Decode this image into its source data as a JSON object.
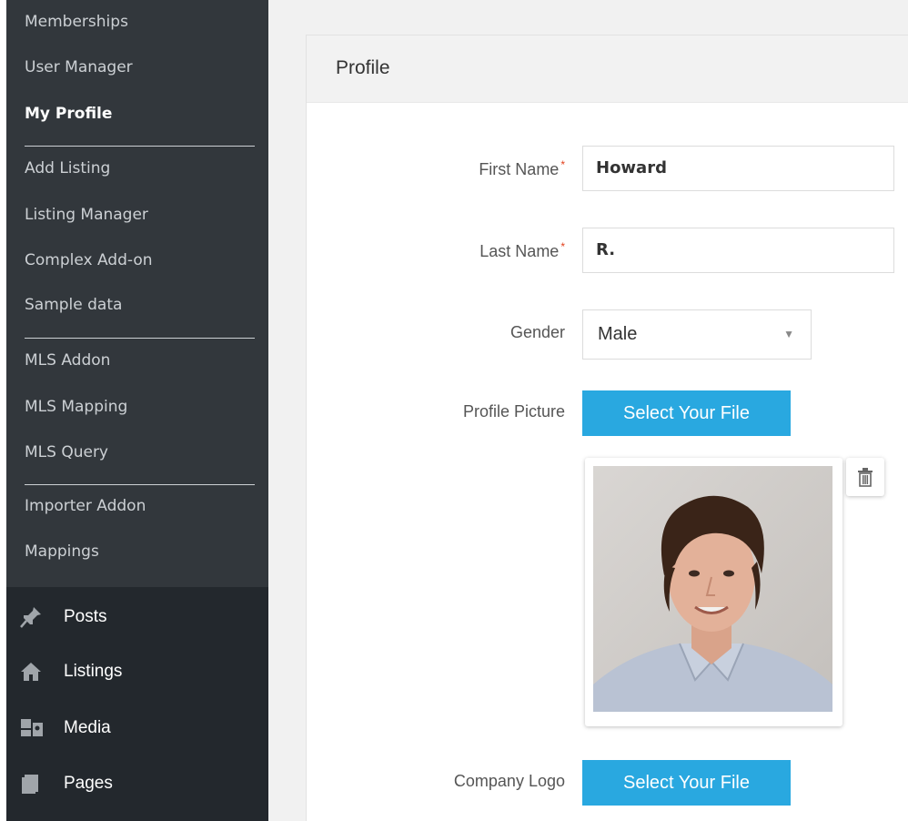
{
  "sidebar": {
    "submenu_items": [
      {
        "label": "Memberships"
      },
      {
        "label": "User Manager"
      },
      {
        "label": "My Profile"
      },
      {
        "label": "Add Listing"
      },
      {
        "label": "Listing Manager"
      },
      {
        "label": "Complex Add-on"
      },
      {
        "label": "Sample data"
      },
      {
        "label": "MLS Addon"
      },
      {
        "label": "MLS Mapping"
      },
      {
        "label": "MLS Query"
      },
      {
        "label": "Importer Addon"
      },
      {
        "label": "Mappings"
      }
    ],
    "menu_items": [
      {
        "label": "Posts",
        "icon": "pin-icon"
      },
      {
        "label": "Listings",
        "icon": "home-icon"
      },
      {
        "label": "Media",
        "icon": "media-icon"
      },
      {
        "label": "Pages",
        "icon": "pages-icon"
      }
    ]
  },
  "panel": {
    "title": "Profile"
  },
  "form": {
    "first_name": {
      "label": "First Name",
      "required_mark": "*",
      "value": "Howard"
    },
    "last_name": {
      "label": "Last Name",
      "required_mark": "*",
      "value": "R."
    },
    "gender": {
      "label": "Gender",
      "value": "Male"
    },
    "profile_picture": {
      "label": "Profile Picture",
      "button": "Select Your File"
    },
    "company_logo": {
      "label": "Company Logo",
      "button": "Select Your File"
    }
  },
  "colors": {
    "sidebar_bg": "#23282d",
    "submenu_bg": "#32373c",
    "button_blue": "#29a8e0",
    "required_red": "#e2401c"
  }
}
